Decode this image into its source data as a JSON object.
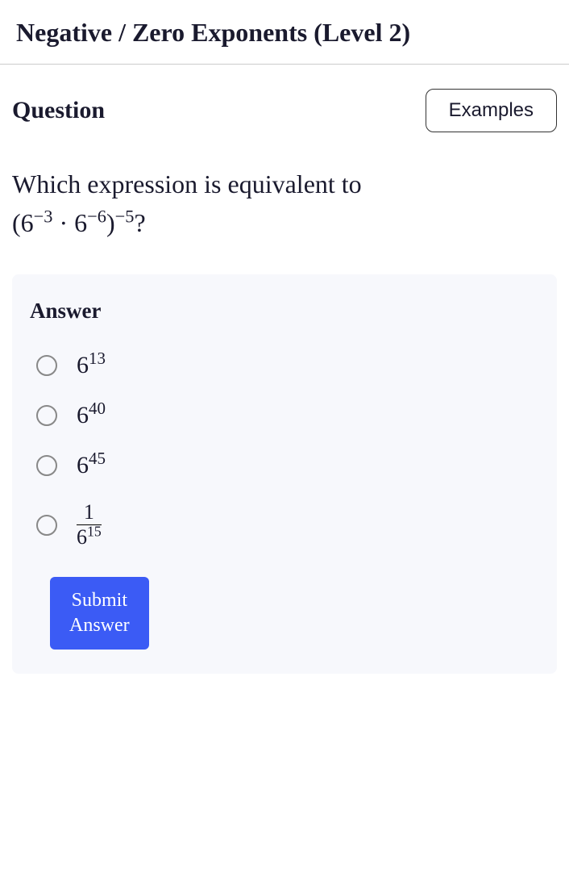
{
  "chart_data": {
    "type": "table",
    "title": "Negative / Zero Exponents (Level 2)",
    "question_prompt": "Which expression is equivalent to (6^(-3) · 6^(-6))^(-5) ?",
    "expression": {
      "base": 6,
      "inner_exponents": [
        -3,
        -6
      ],
      "outer_exponent": -5
    },
    "options": [
      {
        "display": "6^13",
        "base": 6,
        "exponent": 13,
        "is_fraction": false
      },
      {
        "display": "6^40",
        "base": 6,
        "exponent": 40,
        "is_fraction": false
      },
      {
        "display": "6^45",
        "base": 6,
        "exponent": 45,
        "is_fraction": false
      },
      {
        "display": "1 / 6^15",
        "numerator": 1,
        "denominator_base": 6,
        "denominator_exponent": 15,
        "is_fraction": true
      }
    ]
  },
  "title": "Negative / Zero Exponents (Level 2)",
  "header": {
    "question_label": "Question",
    "examples_label": "Examples"
  },
  "question": {
    "prompt_text": "Which expression is equivalent to ",
    "expr_open": "(",
    "expr_base1": "6",
    "expr_exp1": "−3",
    "expr_dot": " · ",
    "expr_base2": "6",
    "expr_exp2": "−6",
    "expr_close": ")",
    "expr_outer_exp": "−5",
    "expr_qmark": "?"
  },
  "answer": {
    "label": "Answer",
    "options": [
      {
        "base": "6",
        "exp": "13"
      },
      {
        "base": "6",
        "exp": "40"
      },
      {
        "base": "6",
        "exp": "45"
      },
      {
        "num": "1",
        "den_base": "6",
        "den_exp": "15"
      }
    ],
    "submit_label": "Submit Answer"
  }
}
